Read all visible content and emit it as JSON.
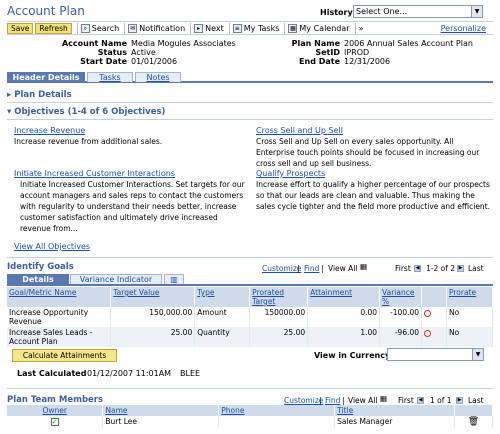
{
  "header": {
    "title": "Account Plan",
    "history_label": "History",
    "history_value": "Select One...",
    "personalize": "Personalize"
  },
  "toolbar": {
    "save": "Save",
    "refresh": "Refresh",
    "search": "Search",
    "notification": "Notification",
    "next": "Next",
    "my_tasks": "My Tasks",
    "my_calendar": "My Calendar",
    "more": "»"
  },
  "plan": {
    "account_name_label": "Account Name",
    "account_name": "Media Mogules Associates",
    "status_label": "Status",
    "status": "Active",
    "start_date_label": "Start Date",
    "start_date": "01/01/2006",
    "plan_name_label": "Plan Name",
    "plan_name": "2006 Annual Sales Account Plan",
    "setid_label": "SetID",
    "setid": "IPROD",
    "end_date_label": "End Date",
    "end_date": "12/31/2006"
  },
  "tabs": [
    "Header Details",
    "Tasks",
    "Notes"
  ],
  "plan_details": "Plan Details",
  "objectives": {
    "title": "Objectives (1-4 of 6 Objectives)",
    "items": [
      {
        "name": "Increase Revenue",
        "desc": "Increase revenue from additional sales."
      },
      {
        "name": "Cross Sell and Up Sell",
        "desc": "Cross Sell and Up Sell on every sales opportunity.  All Enterprise touch points should be focused in increasing our cross sell and up sell business."
      },
      {
        "name": "Initiate Increased Customer Interactions",
        "desc": "Initiate Increased Customer Interactions.  Set targets for our account  managers and sales reps to contact the customers with regularity to understand their needs better, increase customer satisfaction and ultimately drive increased revenue from..."
      },
      {
        "name": "Qualify Prospects",
        "desc": "Increase effort to qualify a higher percentage of our prospects so that our leads are clean and valuable.  Thus making the sales cycle tighter and the field more productive and efficient."
      }
    ],
    "view_all": "View All Objectives"
  },
  "goals": {
    "title": "Identify Goals",
    "customize": "Customize",
    "find": "Find",
    "view_all": "View All",
    "first": "First",
    "range": "1-2 of 2",
    "last": "Last",
    "subtabs": [
      "Details",
      "Variance Indicator"
    ],
    "columns": [
      "Goal/Metric Name",
      "Target Value",
      "Type",
      "Prorated Target",
      "Attainment",
      "Variance %",
      "",
      "Prorate"
    ],
    "rows": [
      {
        "name": "Increase Opportunity Revenue",
        "target": "150,000.00",
        "type": "Amount",
        "prorated": "150000.00",
        "attainment": "0.00",
        "variance": "-100.00",
        "prorate": "No"
      },
      {
        "name": "Increase Sales Leads - Account Plan",
        "target": "25.00",
        "type": "Quantity",
        "prorated": "25.00",
        "attainment": "1.00",
        "variance": "-96.00",
        "prorate": "No"
      }
    ],
    "calculate_button": "Calculate Attainments",
    "currency_label": "View in Currency",
    "last_calculated_label": "Last Calculated",
    "last_calculated_value": "01/12/2007 11:01AM",
    "last_calculated_by": "BLEE"
  },
  "team": {
    "title": "Plan Team Members",
    "customize": "Customize",
    "find": "Find",
    "view_all": "View All",
    "first": "First",
    "range": "1 of 1",
    "last": "Last",
    "columns": [
      "Owner",
      "Name",
      "Phone",
      "Title"
    ],
    "rows": [
      {
        "name": "Burt Lee",
        "phone": "",
        "title": "Sales Manager"
      }
    ]
  }
}
